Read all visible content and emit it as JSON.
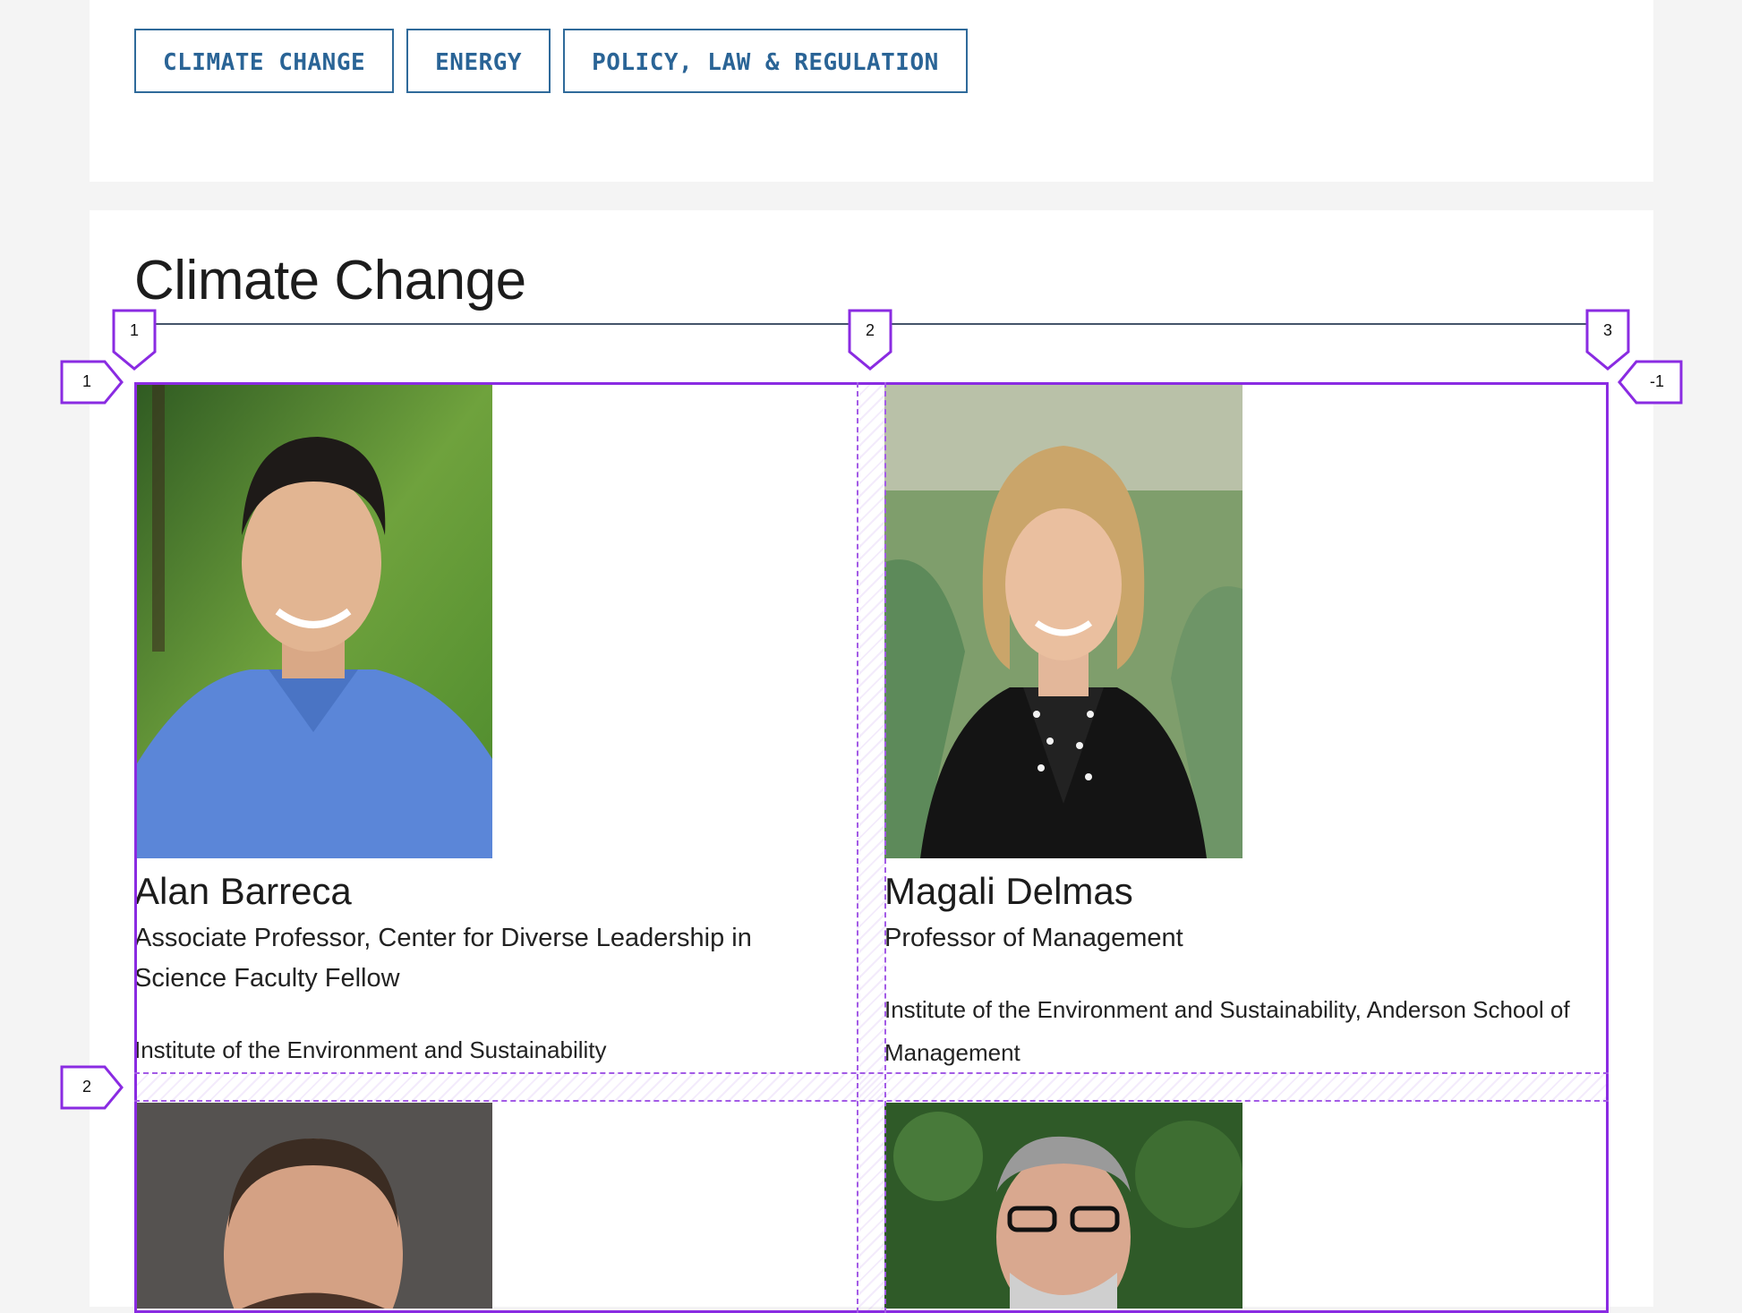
{
  "tags": [
    "CLIMATE CHANGE",
    "ENERGY",
    "POLICY, LAW & REGULATION"
  ],
  "section": {
    "title": "Climate Change"
  },
  "people": [
    {
      "name": "Alan Barreca",
      "title": "Associate Professor, Center for Diverse Leadership in Science Faculty Fellow",
      "department": "Institute of the Environment and Sustainability"
    },
    {
      "name": "Magali Delmas",
      "title": "Professor of Management",
      "department": "Institute of the Environment and Sustainability, Anderson School of Management"
    }
  ],
  "grid_overlay": {
    "column_labels": [
      "1",
      "2",
      "3"
    ],
    "row_labels": [
      "1",
      "2"
    ],
    "end_label": "-1",
    "color": "#8a2be2"
  },
  "colors": {
    "tag_text": "#2a6496",
    "background": "#f4f4f4",
    "panel": "#ffffff"
  }
}
